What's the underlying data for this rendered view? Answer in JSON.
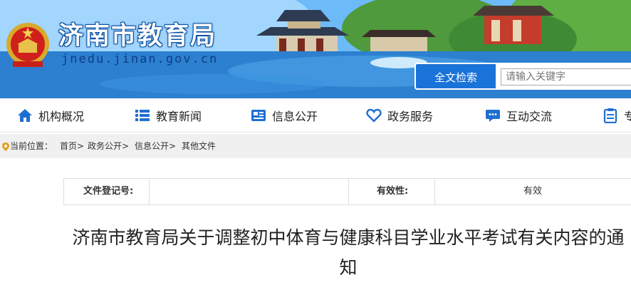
{
  "header": {
    "site_title": "济南市教育局",
    "site_url": "jnedu.jinan.gov.cn",
    "emblem_icon": "national-emblem-icon"
  },
  "search": {
    "label": "全文检索",
    "placeholder": "请输入关键字"
  },
  "nav": {
    "items": [
      {
        "label": "机构概况",
        "icon": "home-icon"
      },
      {
        "label": "教育新闻",
        "icon": "list-icon"
      },
      {
        "label": "信息公开",
        "icon": "news-icon"
      },
      {
        "label": "政务服务",
        "icon": "heart-icon"
      },
      {
        "label": "互动交流",
        "icon": "chat-icon"
      },
      {
        "label": "专",
        "icon": "clipboard-icon"
      }
    ]
  },
  "breadcrumb": {
    "prefix": "当前位置：",
    "items": [
      "首页>",
      "政务公开>",
      "信息公开>",
      "其他文件"
    ]
  },
  "meta": {
    "doc_no_label": "文件登记号:",
    "doc_no_value": "",
    "validity_label": "有效性:",
    "validity_value": "有效"
  },
  "article": {
    "title": "济南市教育局关于调整初中体育与健康科目学业水平考试有关内容的通知"
  },
  "colors": {
    "brand_blue": "#1a73d9",
    "nav_icon_blue": "#1f6fd1",
    "title_outline": "#0a4fa0"
  }
}
